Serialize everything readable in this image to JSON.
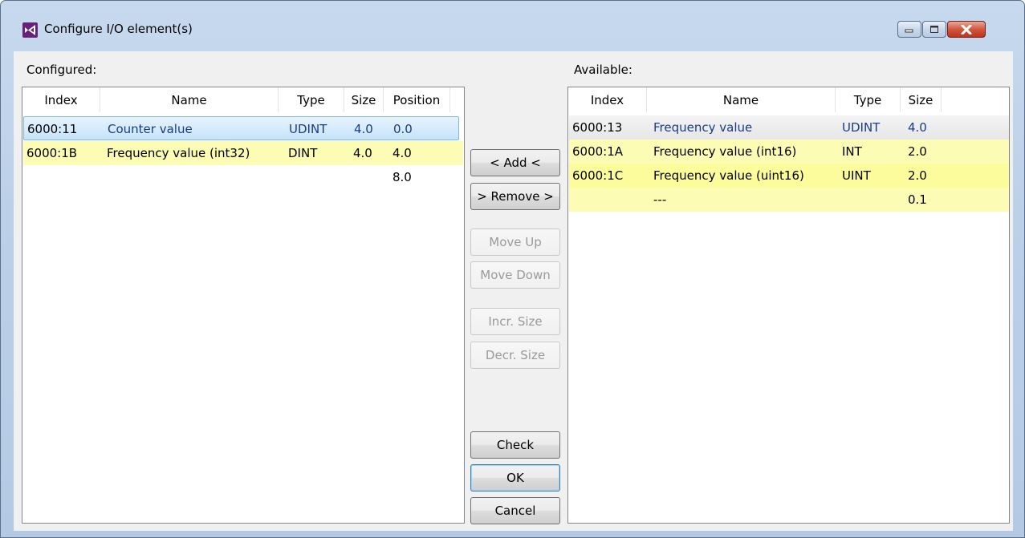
{
  "window": {
    "title": "Configure I/O element(s)",
    "icons": {
      "app": "visual-studio-icon",
      "minimize": "minimize-icon",
      "maximize": "maximize-icon",
      "close": "close-icon"
    }
  },
  "configured": {
    "label": "Configured:",
    "columns": [
      "Index",
      "Name",
      "Type",
      "Size",
      "Position"
    ],
    "rows": [
      {
        "index": "6000:11",
        "name": "Counter value",
        "type": "UDINT",
        "size": "4.0",
        "position": "0.0"
      },
      {
        "index": "6000:1B",
        "name": "Frequency value (int32)",
        "type": "DINT",
        "size": "4.0",
        "position": "4.0"
      },
      {
        "position": "8.0"
      }
    ]
  },
  "available": {
    "label": "Available:",
    "columns": [
      "Index",
      "Name",
      "Type",
      "Size"
    ],
    "rows": [
      {
        "index": "6000:13",
        "name": "Frequency value",
        "type": "UDINT",
        "size": "4.0"
      },
      {
        "index": "6000:1A",
        "name": "Frequency value (int16)",
        "type": "INT",
        "size": "2.0"
      },
      {
        "index": "6000:1C",
        "name": "Frequency value (uint16)",
        "type": "UINT",
        "size": "2.0"
      },
      {
        "name": "---",
        "size": "0.1"
      }
    ]
  },
  "buttons": {
    "add": "< Add <",
    "remove": "> Remove >",
    "move_up": "Move Up",
    "move_down": "Move Down",
    "incr_size": "Incr. Size",
    "decr_size": "Decr. Size",
    "check": "Check",
    "ok": "OK",
    "cancel": "Cancel"
  },
  "colors": {
    "selected_row": "#c7e4fa",
    "highlight_row": "#fcfcb4",
    "name_text": "#1a3a8a"
  }
}
